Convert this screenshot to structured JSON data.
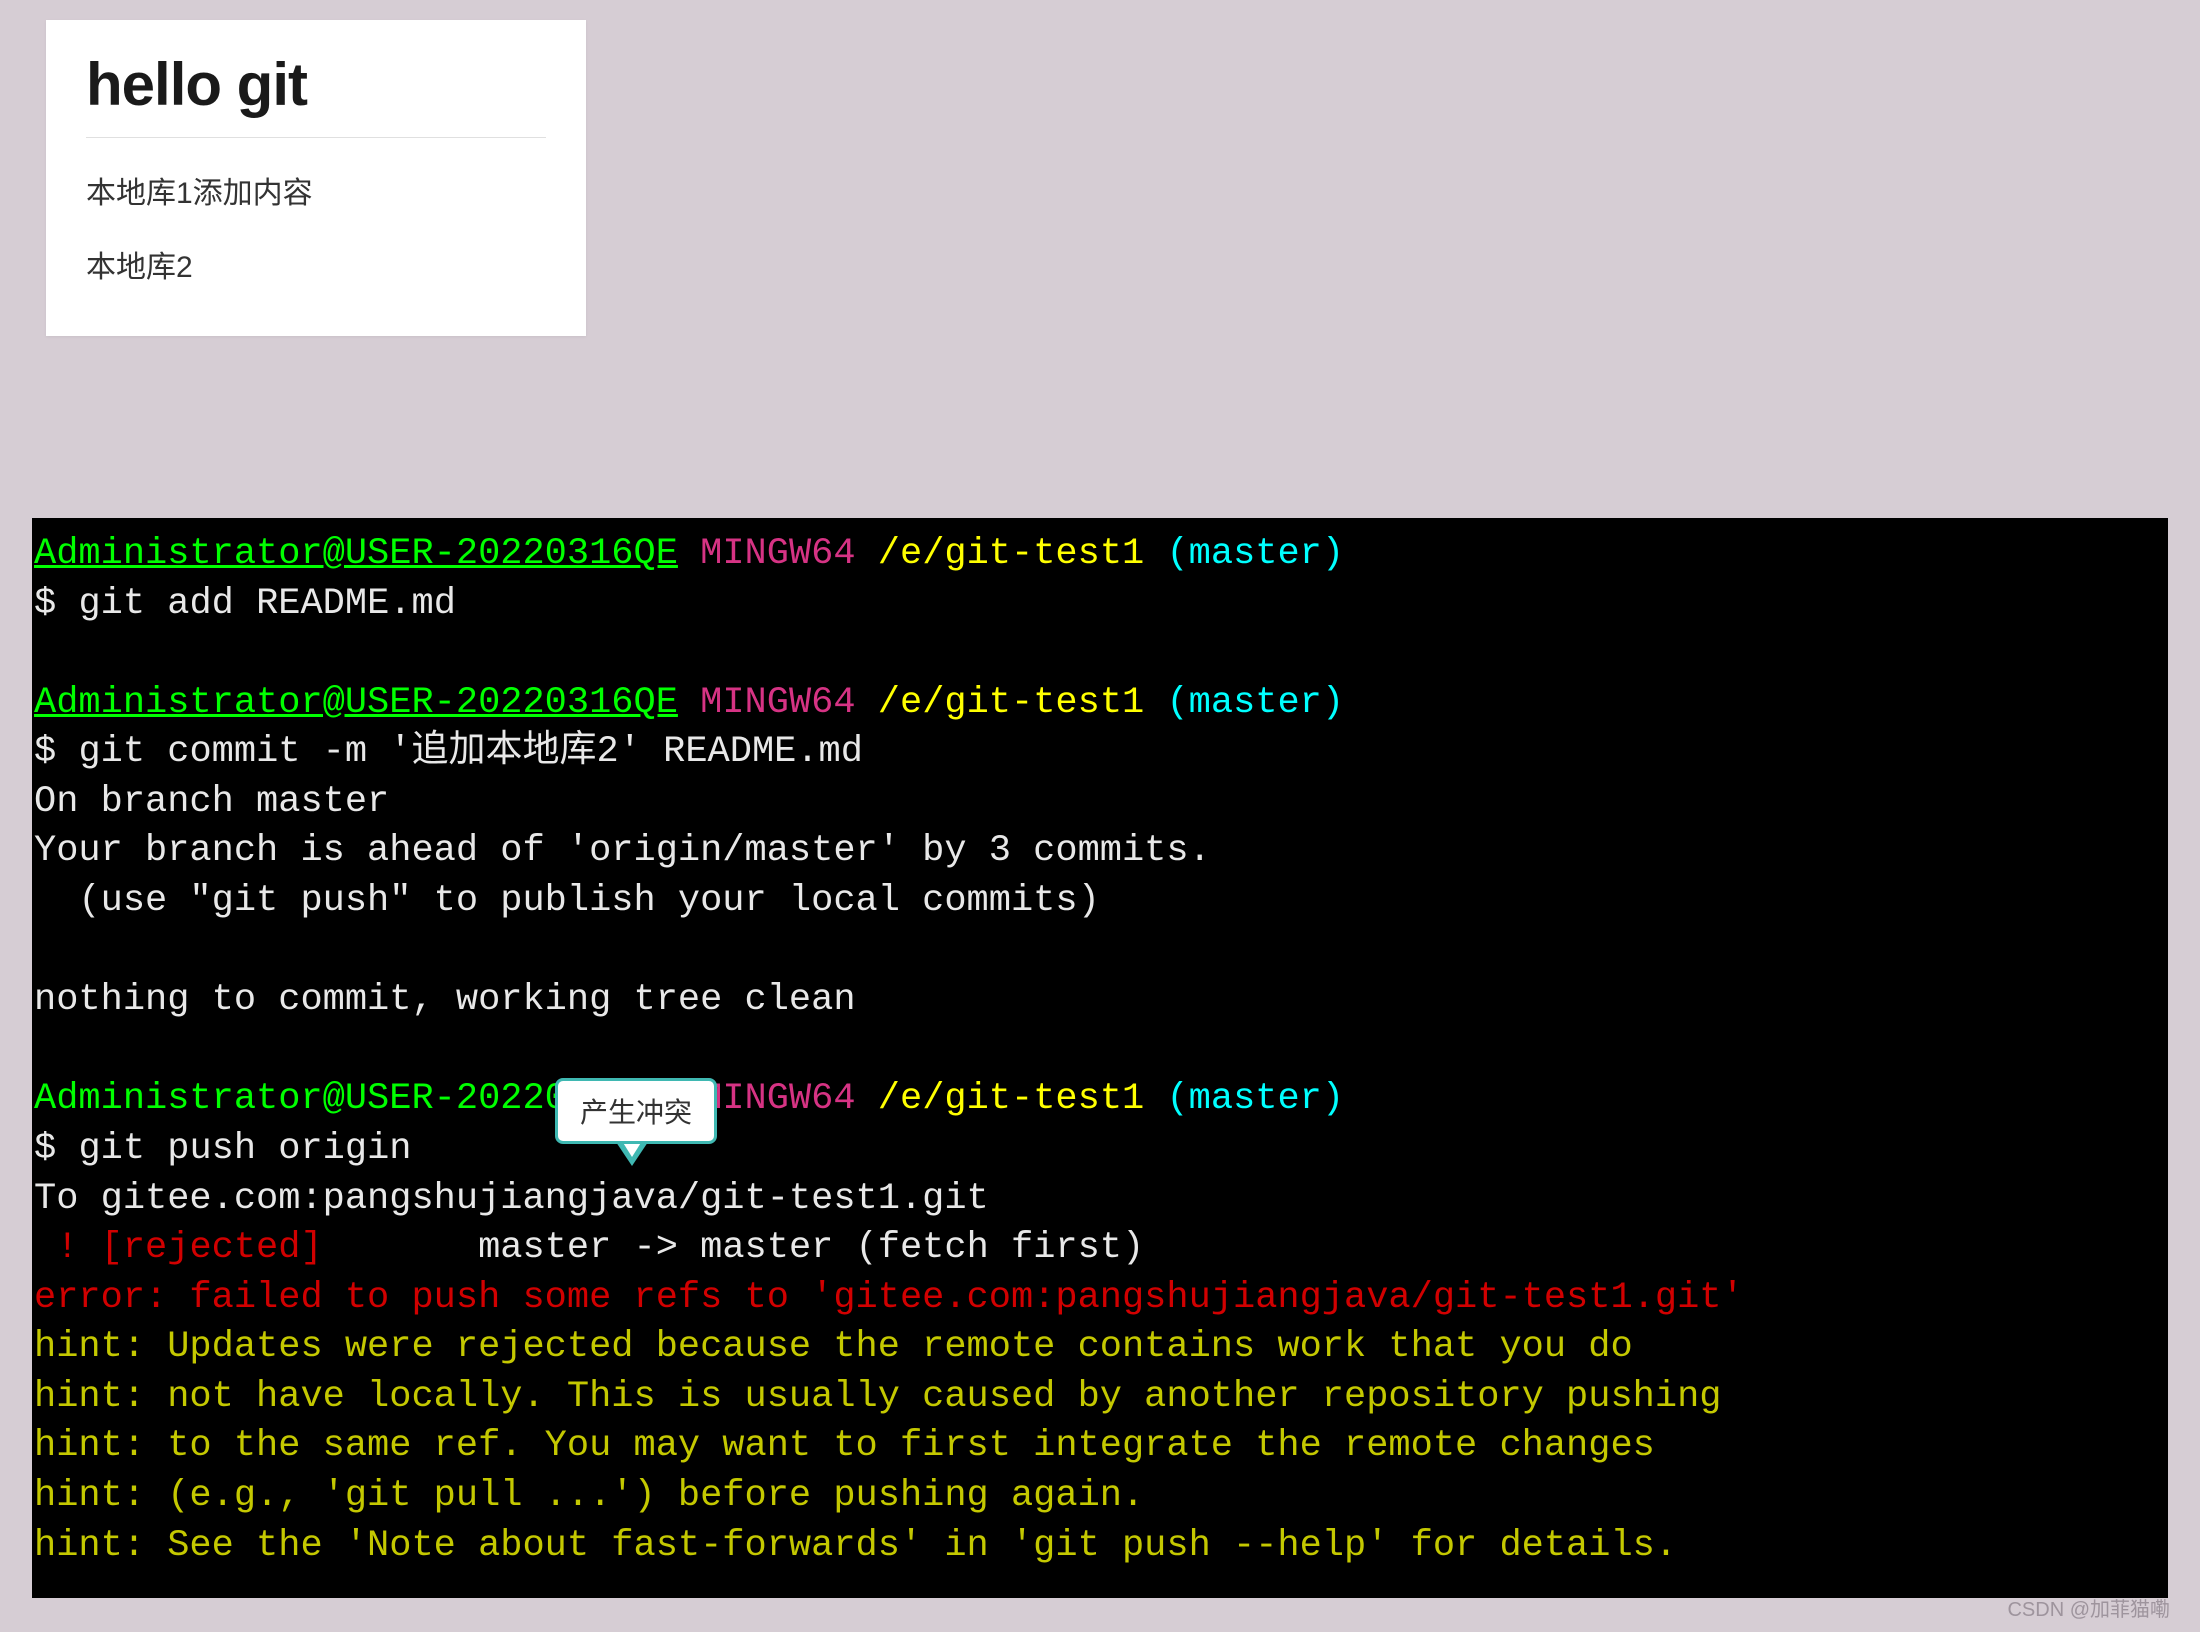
{
  "card": {
    "title": "hello git",
    "items": [
      "本地库1添加内容",
      "本地库2"
    ]
  },
  "bubble": {
    "text": "产生冲突"
  },
  "prompt": {
    "user_host": "Administrator@USER-20220316QE",
    "env": "MINGW64",
    "path": "/e/git-test1",
    "branch": "(master)",
    "symbol": "$"
  },
  "terminal": {
    "cmd1": "git add README.md",
    "cmd2_prefix": "git commit -m '",
    "cmd2_cn": "追加本地库2",
    "cmd2_suffix": "' README.md",
    "out2_l1": "On branch master",
    "out2_l2": "Your branch is ahead of 'origin/master' by 3 commits.",
    "out2_l3": "  (use \"git push\" to publish your local commits)",
    "out2_l4": "nothing to commit, working tree clean",
    "cmd3": "git push origin",
    "out3_to": "To gitee.com:pangshujiangjava/git-test1.git",
    "out3_rej_bang": " ! ",
    "out3_rej_label": "[rejected]",
    "out3_rej_rest": "       master -> master (fetch first)",
    "out3_error": "error: failed to push some refs to 'gitee.com:pangshujiangjava/git-test1.git'",
    "hint1": "hint: Updates were rejected because the remote contains work that you do",
    "hint2": "hint: not have locally. This is usually caused by another repository pushing",
    "hint3": "hint: to the same ref. You may want to first integrate the remote changes",
    "hint4": "hint: (e.g., 'git pull ...') before pushing again.",
    "hint5": "hint: See the 'Note about fast-forwards' in 'git push --help' for details."
  },
  "watermark": "CSDN @加菲猫嘞"
}
